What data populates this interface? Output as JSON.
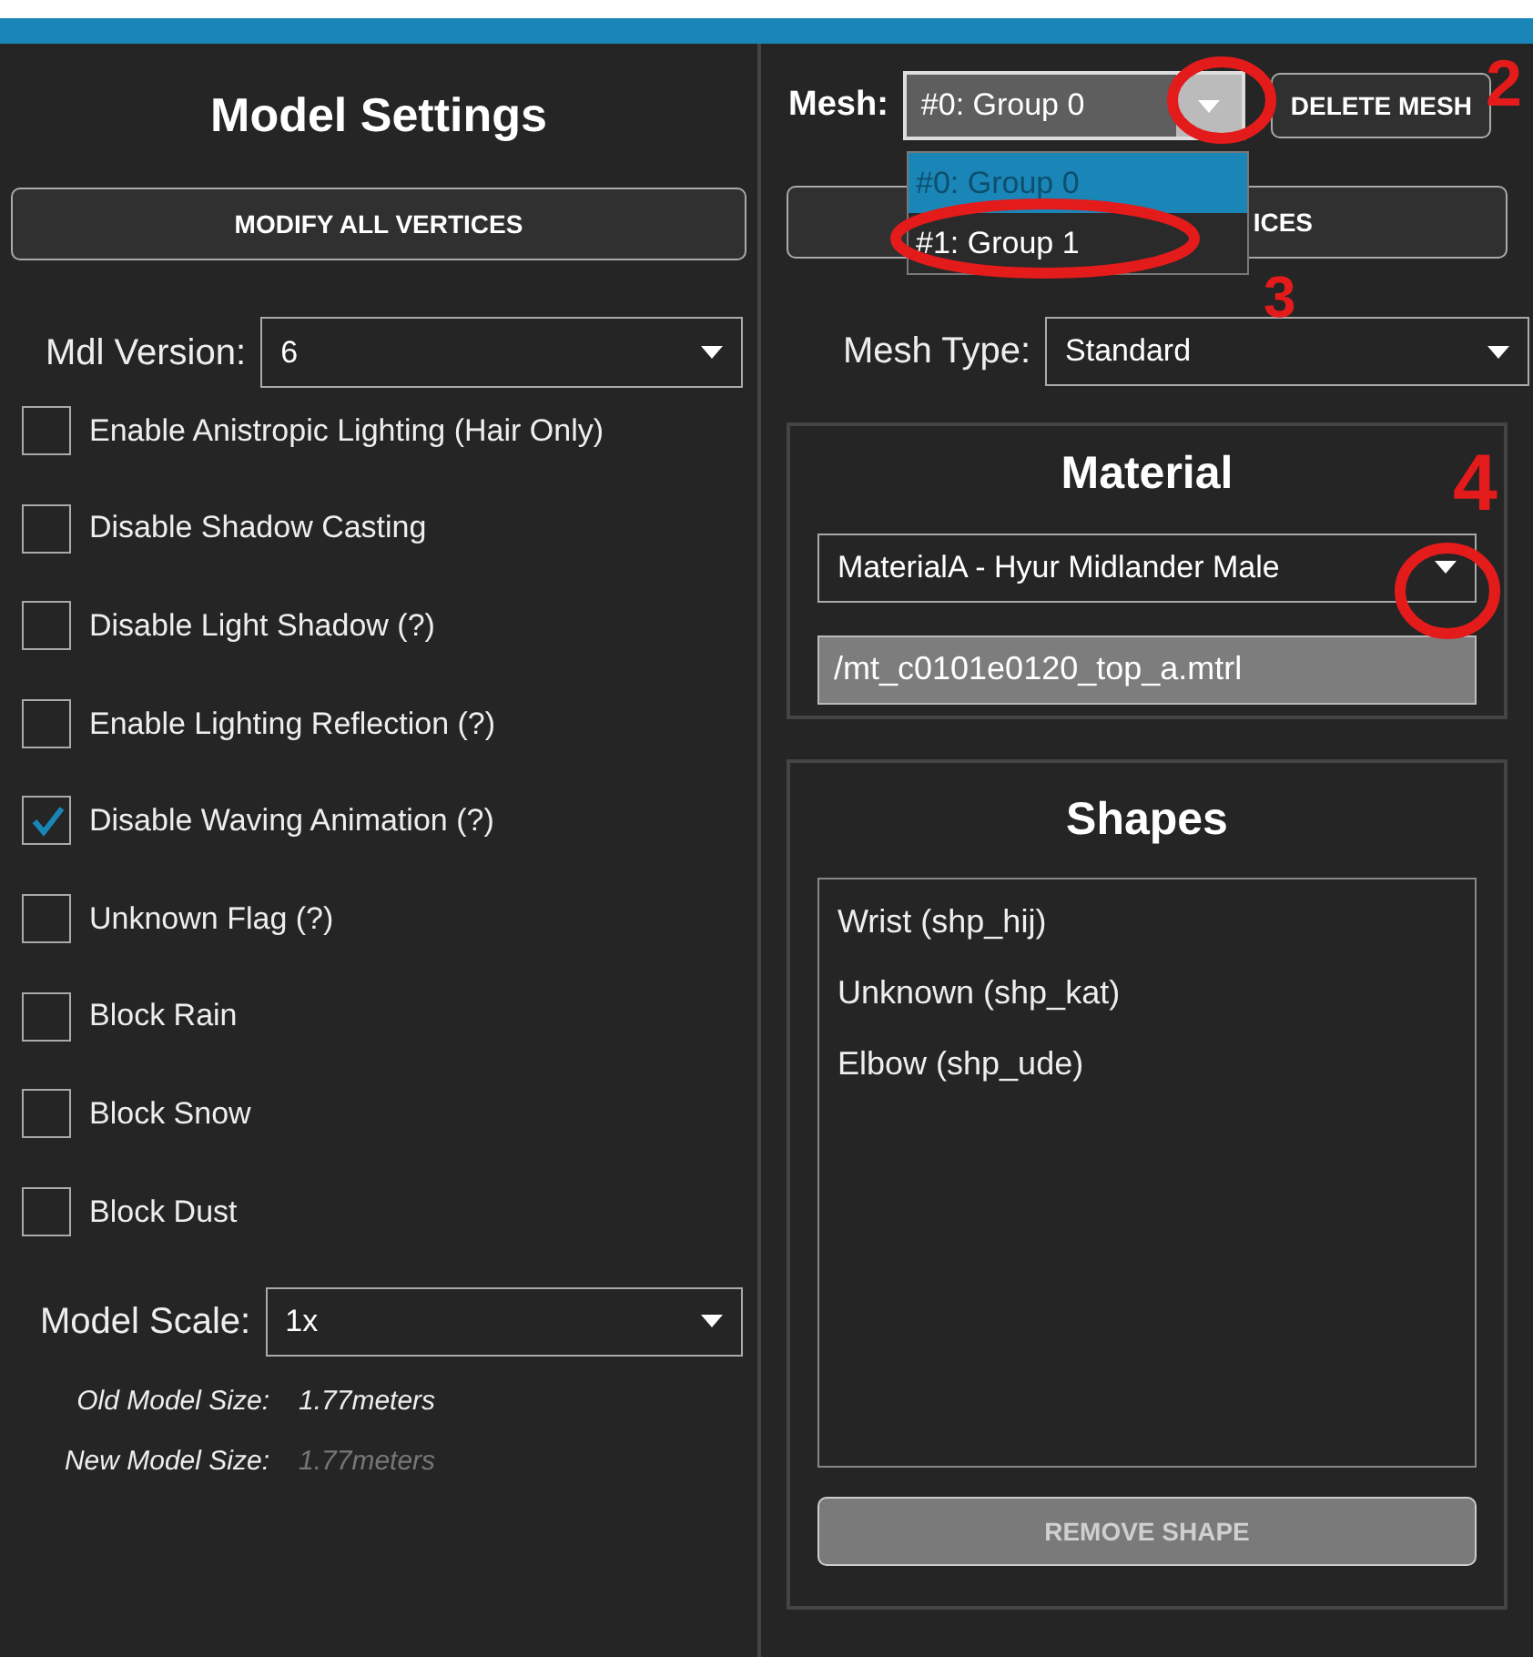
{
  "left": {
    "title": "Model Settings",
    "modify_button": "MODIFY ALL VERTICES",
    "mdl_version": {
      "label": "Mdl Version:",
      "value": "6"
    },
    "flags": [
      {
        "label": "Enable Anistropic Lighting (Hair Only)",
        "checked": false
      },
      {
        "label": "Disable Shadow Casting",
        "checked": false
      },
      {
        "label": "Disable Light Shadow (?)",
        "checked": false
      },
      {
        "label": "Enable Lighting Reflection (?)",
        "checked": false
      },
      {
        "label": "Disable Waving Animation (?)",
        "checked": true
      },
      {
        "label": "Unknown Flag (?)",
        "checked": false
      },
      {
        "label": "Block Rain",
        "checked": false
      },
      {
        "label": "Block Snow",
        "checked": false
      },
      {
        "label": "Block Dust",
        "checked": false
      }
    ],
    "model_scale": {
      "label": "Model Scale:",
      "value": "1x"
    },
    "sizes": [
      {
        "label": "Old Model Size:",
        "value": "1.77meters",
        "disabled": false
      },
      {
        "label": "New Model Size:",
        "value": "1.77meters",
        "disabled": true
      }
    ]
  },
  "right": {
    "mesh": {
      "label": "Mesh:",
      "value": "#0: Group 0",
      "expanded": true,
      "options": [
        {
          "label": "#0: Group 0",
          "selected": true
        },
        {
          "label": "#1: Group 1",
          "selected": false
        }
      ]
    },
    "delete_button": "DELETE MESH",
    "modify_button": "ICES",
    "mesh_type": {
      "label": "Mesh Type:",
      "value": "Standard"
    },
    "material": {
      "title": "Material",
      "value": "MaterialA - Hyur Midlander Male",
      "path": "/mt_c0101e0120_top_a.mtrl"
    },
    "shapes": {
      "title": "Shapes",
      "items": [
        "Wrist (shp_hij)",
        "Unknown (shp_kat)",
        "Elbow (shp_ude)"
      ],
      "remove_button": "REMOVE SHAPE",
      "remove_disabled": true
    }
  },
  "annotations": [
    {
      "label": "2"
    },
    {
      "label": "3"
    },
    {
      "label": "4"
    }
  ]
}
